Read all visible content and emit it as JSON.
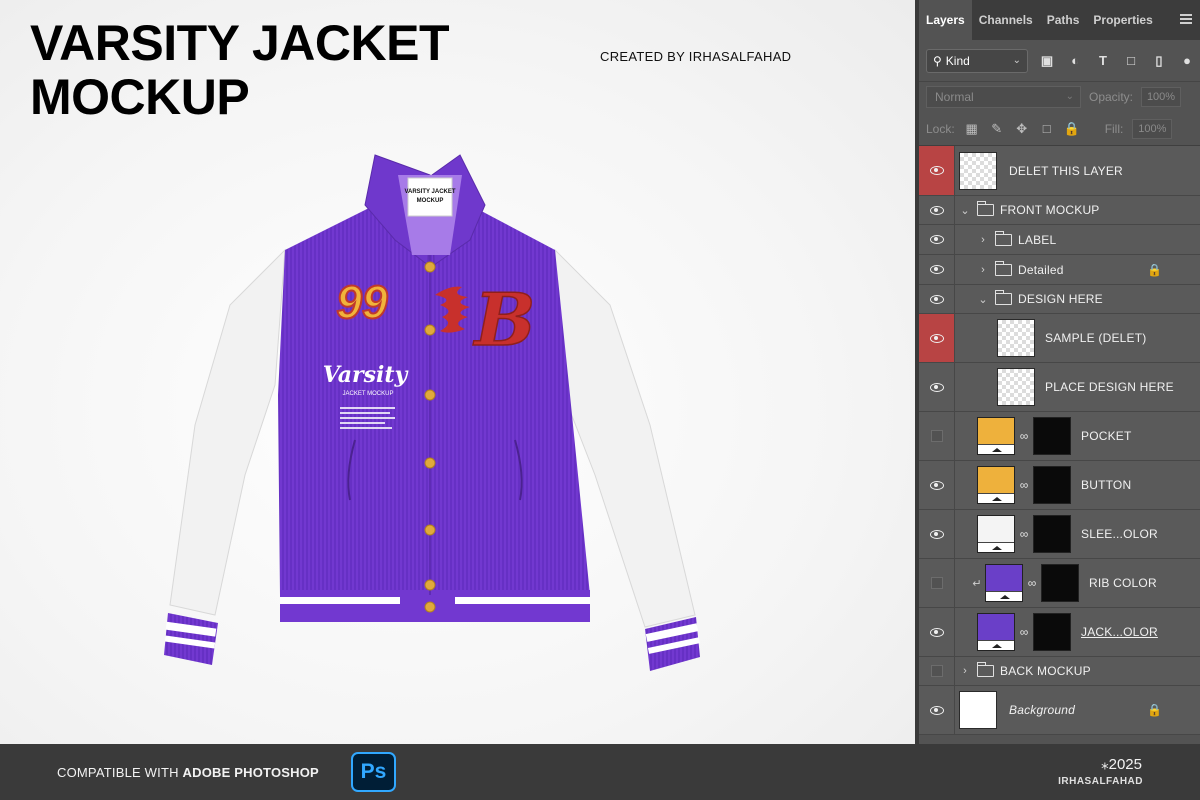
{
  "canvas": {
    "title_line1": "VARSITY JACKET",
    "title_line2": "MOCKUP",
    "credit": "CREATED BY IRHASALFAHAD",
    "jacket": {
      "number": "99",
      "logo_letter": "B",
      "script_text": "Varsity",
      "script_sub": "JACKET MOCKUP",
      "label_line1": "VARSITY JACKET",
      "label_line2": "MOCKUP",
      "body_color": "#7b3fd6",
      "sleeve_color": "#f2f2f2"
    }
  },
  "panel": {
    "tabs": [
      {
        "label": "Layers",
        "active": true
      },
      {
        "label": "Channels",
        "active": false
      },
      {
        "label": "Paths",
        "active": false
      },
      {
        "label": "Properties",
        "active": false
      }
    ],
    "filter": {
      "kind_label": "Kind"
    },
    "blend": {
      "mode": "Normal",
      "opacity_label": "Opacity:",
      "opacity_value": "100%"
    },
    "lock": {
      "label": "Lock:",
      "fill_label": "Fill:",
      "fill_value": "100%"
    },
    "layers": [
      {
        "name": "DELET THIS LAYER",
        "visible": true,
        "highlight": true
      },
      {
        "name": "FRONT MOCKUP",
        "visible": true,
        "type": "group",
        "expanded": true
      },
      {
        "name": "LABEL",
        "visible": true,
        "type": "group",
        "expanded": false
      },
      {
        "name": "Detailed",
        "visible": true,
        "type": "group",
        "expanded": false,
        "locked": true
      },
      {
        "name": "DESIGN HERE",
        "visible": true,
        "type": "group",
        "expanded": true
      },
      {
        "name": "SAMPLE (DELET)",
        "visible": true,
        "highlight": true
      },
      {
        "name": "PLACE DESIGN HERE",
        "visible": true
      },
      {
        "name": "POCKET",
        "visible": false,
        "fill": "#eeb13c"
      },
      {
        "name": "BUTTON",
        "visible": true,
        "fill": "#eeb13c"
      },
      {
        "name": "SLEE...OLOR",
        "visible": true,
        "fill": "#f4f4f4"
      },
      {
        "name": "RIB COLOR",
        "visible": false,
        "fill": "#6a3fc8"
      },
      {
        "name": "JACK...OLOR",
        "visible": true,
        "fill": "#6a3fc8"
      },
      {
        "name": "BACK MOCKUP",
        "visible": false,
        "type": "group",
        "expanded": false
      },
      {
        "name": "Background",
        "visible": true,
        "locked": true
      }
    ]
  },
  "footer": {
    "compat_prefix": "COMPATIBLE WITH",
    "compat_app": "ADOBE PHOTOSHOP",
    "ps_badge": "Ps",
    "year": "⁎2025",
    "brand": "IRHASALFAHAD"
  }
}
